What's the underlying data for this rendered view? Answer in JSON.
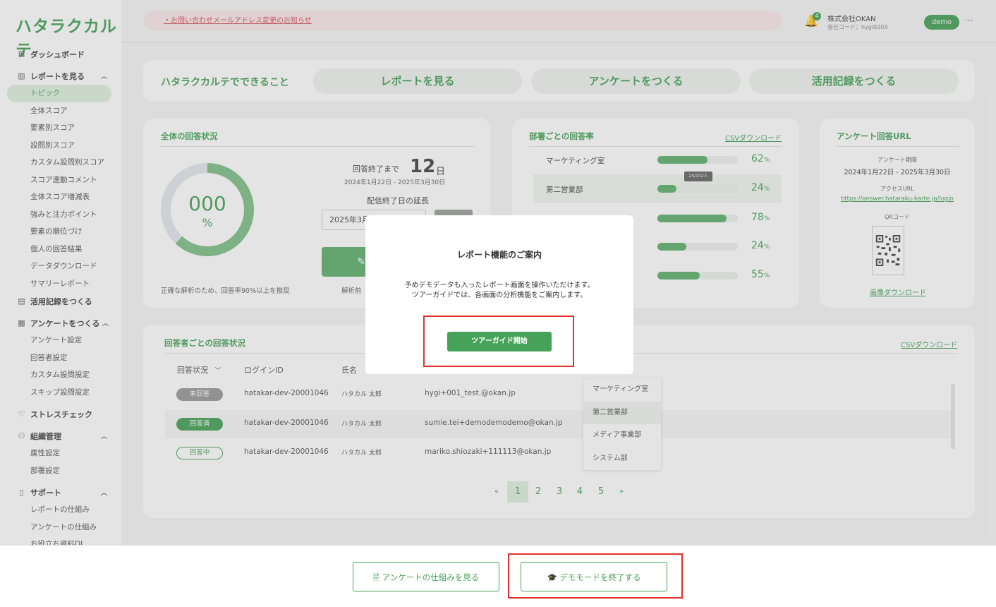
{
  "brand": {
    "logo": "ハタラクカルテ",
    "accent": "#46a258"
  },
  "sidebar": {
    "dashboard": "ダッシュボード",
    "reports": {
      "label": "レポートを見る",
      "items": [
        "トピック",
        "全体スコア",
        "要素別スコア",
        "設問別スコア",
        "カスタム設問別スコア",
        "スコア連動コメント",
        "全体スコア増減表",
        "強みと注力ポイント",
        "要素の順位づけ",
        "個人の回答結果",
        "データダウンロード",
        "サマリーレポート"
      ]
    },
    "activity": "活用記録をつくる",
    "survey": {
      "label": "アンケートをつくる",
      "items": [
        "アンケート設定",
        "回答者設定",
        "カスタム設問設定",
        "スキップ設問設定"
      ]
    },
    "stress": "ストレスチェック",
    "org": {
      "label": "組織管理",
      "items": [
        "属性設定",
        "部署設定"
      ]
    },
    "support": {
      "label": "サポート",
      "items": [
        "レポートの仕組み",
        "アンケートの仕組み",
        "お役立ち資料DL"
      ]
    }
  },
  "header": {
    "notice": "・お問い合わせメールアドレス変更のお知らせ",
    "bell_count": "4",
    "company": "株式会社OKAN",
    "company_code": "会社コード：hygi0203",
    "user": "demo",
    "more": "···"
  },
  "feature_bar": {
    "title": "ハタラクカルテでできること",
    "buttons": [
      "レポートを見る",
      "アンケートをつくる",
      "活用記録をつくる"
    ]
  },
  "overall": {
    "title": "全体の回答状況",
    "rate": "000",
    "unit": "%",
    "fill_fraction": 0.62,
    "until_label": "回答終了まで",
    "days": "12",
    "days_unit": "日",
    "period": "2024年1月22日 - 2025年3月30日",
    "extend_label": "配信終了日の延長",
    "date_value": "2025年3月",
    "note": "正確な解析のため、回答率90%以上を推奨",
    "note2": "解析前"
  },
  "dept": {
    "title": "部署ごとの回答率",
    "csv": "CSVダウンロード",
    "tooltip": "24/102人",
    "rows": [
      {
        "name": "マーケティング室",
        "pct": "62",
        "fill": 0.62
      },
      {
        "name": "第二営業部",
        "pct": "24",
        "fill": 0.24
      },
      {
        "name": "",
        "pct": "78",
        "fill": 0.86
      },
      {
        "name": "",
        "pct": "24",
        "fill": 0.36
      },
      {
        "name": "",
        "pct": "55",
        "fill": 0.53
      }
    ]
  },
  "survey_url": {
    "title": "アンケート回答URL",
    "period_label": "アンケート期間",
    "period": "2024年1月22日 - 2025年3月30日",
    "access_label": "アクセスURL",
    "url": "https://answer.hataraku-karte.jp/login",
    "qr_label": "QRコード",
    "download": "画像ダウンロード"
  },
  "respondents": {
    "title": "回答者ごとの回答状況",
    "csv": "CSVダウンロード",
    "headers": {
      "status": "回答状況",
      "login": "ログインID",
      "name": "氏名"
    },
    "rows": [
      {
        "status": "未回答",
        "login": "hatakar-dev-20001046",
        "name": "ハタカル 太郎",
        "email": "hygi+001_test.@okan.jp"
      },
      {
        "status": "回答済",
        "login": "hatakar-dev-20001046",
        "name": "ハタカル 太郎",
        "email": "sumie.tei+demodemodemo@okan.jp"
      },
      {
        "status": "回答中",
        "login": "hatakar-dev-20001046",
        "name": "ハタカル 太郎",
        "email": "mariko.shiozaki+111113@okan.jp"
      }
    ],
    "dept_options": [
      "マーケティング室",
      "第二営業部",
      "メディア事業部",
      "システム部"
    ],
    "pager": {
      "prev": "«",
      "pages": [
        "1",
        "2",
        "3",
        "4",
        "5"
      ],
      "next": "»"
    }
  },
  "modal": {
    "title": "レポート機能のご案内",
    "line1": "予めデモデータも入ったレポート画面を操作いただけます。",
    "line2": "ツアーガイドでは、各画面の分析機能をご案内します。",
    "button": "ツアーガイド開始"
  },
  "footer": {
    "how_button": "アンケートの仕組みを見る",
    "exit_demo": "デモモードを終了する"
  }
}
